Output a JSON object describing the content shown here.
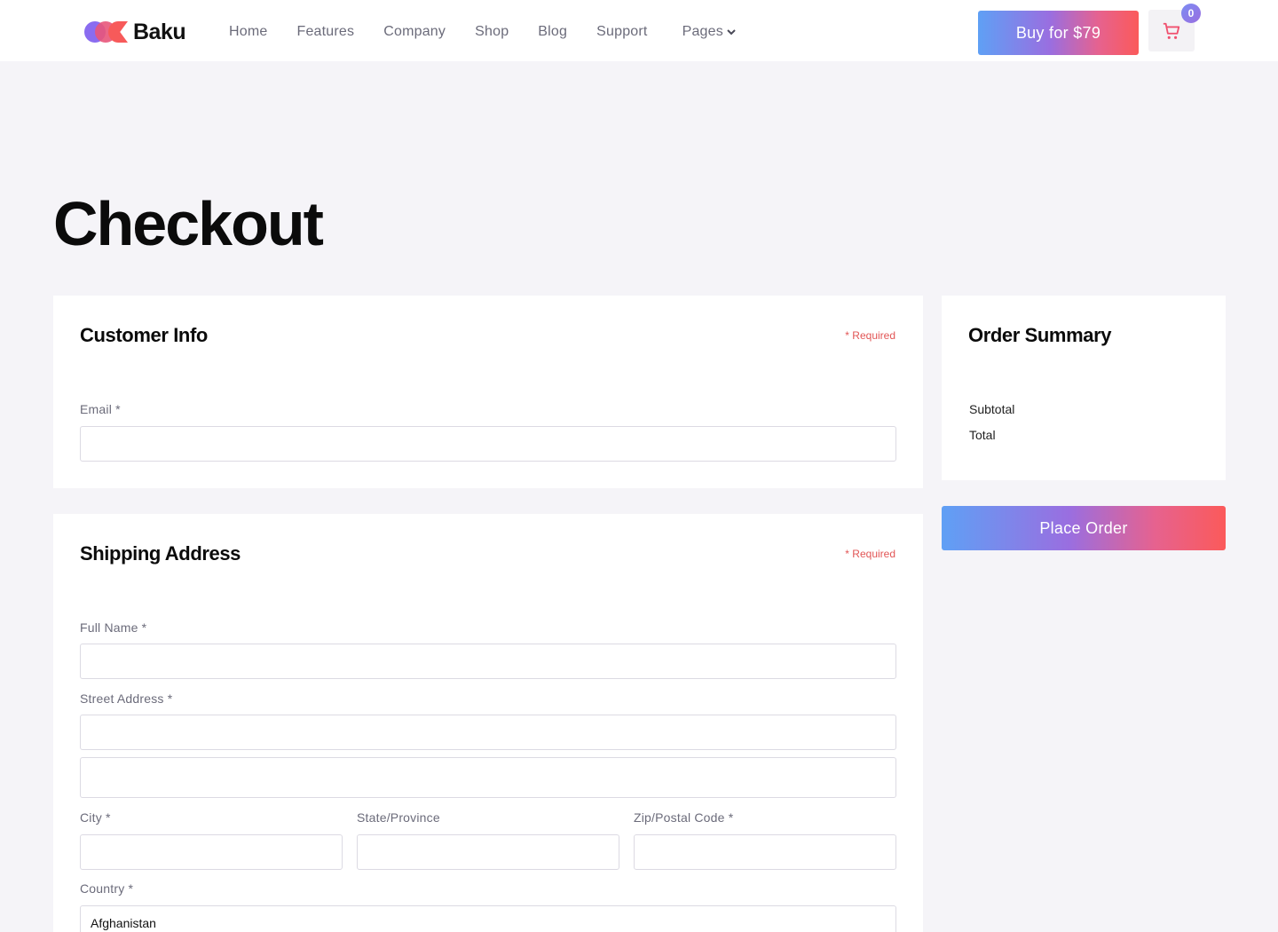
{
  "brand": {
    "name": "Baku"
  },
  "nav": {
    "items": [
      "Home",
      "Features",
      "Company",
      "Shop",
      "Blog",
      "Support"
    ],
    "pages_label": "Pages"
  },
  "header": {
    "buy_label": "Buy for $79",
    "cart_count": "0",
    "cart_icon": "cart-icon"
  },
  "page": {
    "title": "Checkout"
  },
  "customer_info": {
    "title": "Customer Info",
    "required_note": "* Required",
    "email_label": "Email *",
    "email_value": ""
  },
  "shipping": {
    "title": "Shipping Address",
    "required_note": "* Required",
    "full_name_label": "Full Name *",
    "street_label": "Street Address *",
    "city_label": "City *",
    "state_label": "State/Province",
    "zip_label": "Zip/Postal Code *",
    "country_label": "Country *",
    "country_value": "Afghanistan"
  },
  "summary": {
    "title": "Order Summary",
    "subtotal_label": "Subtotal",
    "total_label": "Total"
  },
  "actions": {
    "place_order_label": "Place Order"
  },
  "colors": {
    "accent_start": "#5fa0f5",
    "accent_mid": "#9a6ee0",
    "accent_end": "#fb5a5a",
    "required": "#e25555",
    "background": "#f5f4f8"
  }
}
